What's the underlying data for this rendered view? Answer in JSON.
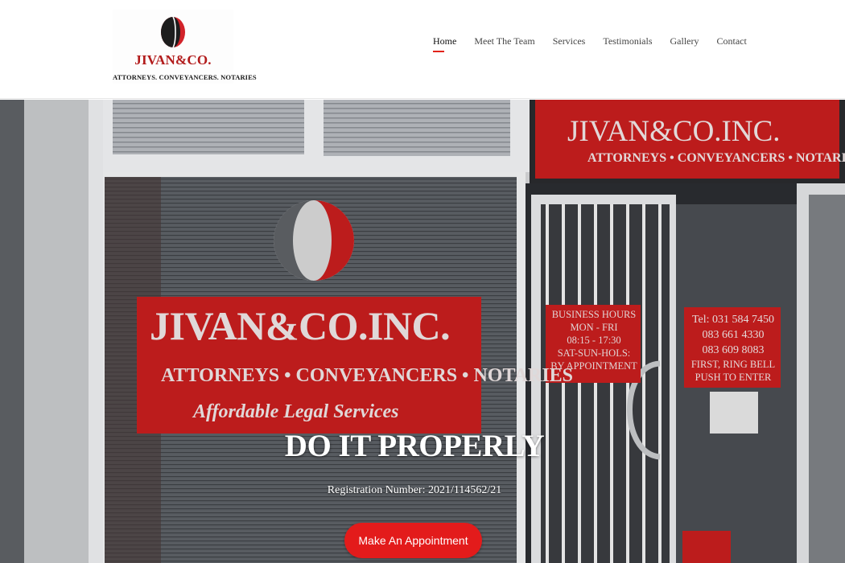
{
  "logo": {
    "name": "JIVAN&CO.",
    "tagline": "ATTORNEYS. CONVEYANCERS. NOTARIES"
  },
  "nav": {
    "items": [
      {
        "label": "Home",
        "active": true
      },
      {
        "label": "Meet The Team",
        "active": false
      },
      {
        "label": "Services",
        "active": false
      },
      {
        "label": "Testimonials",
        "active": false
      },
      {
        "label": "Gallery",
        "active": false
      },
      {
        "label": "Contact",
        "active": false
      }
    ]
  },
  "hero": {
    "title": "DO IT PROPERLY",
    "registration": "Registration Number: 2021/114562/21",
    "cta_label": "Make An Appointment",
    "photo": {
      "sign_top_name": "JIVAN&CO.INC.",
      "sign_top_sub": "ATTORNEYS • CONVEYANCERS • NOTARIES",
      "sign_main_name": "JIVAN&CO.INC.",
      "sign_main_sub": "ATTORNEYS • CONVEYANCERS • NOTARIES",
      "sign_main_slogan": "Affordable Legal Services",
      "hours_lines": [
        "BUSINESS HOURS",
        "MON - FRI",
        "08:15 - 17:30",
        "SAT-SUN-HOLS:",
        "BY APPOINTMENT"
      ],
      "contact_lines": [
        "Tel: 031 584 7450",
        "083 661 4330",
        "083 609 8083",
        "FIRST, RING BELL",
        "PUSH TO ENTER"
      ]
    }
  },
  "colors": {
    "brand_red": "#e31b1b",
    "logo_red": "#b21b1b",
    "nav_active_underline": "#e2231a"
  }
}
